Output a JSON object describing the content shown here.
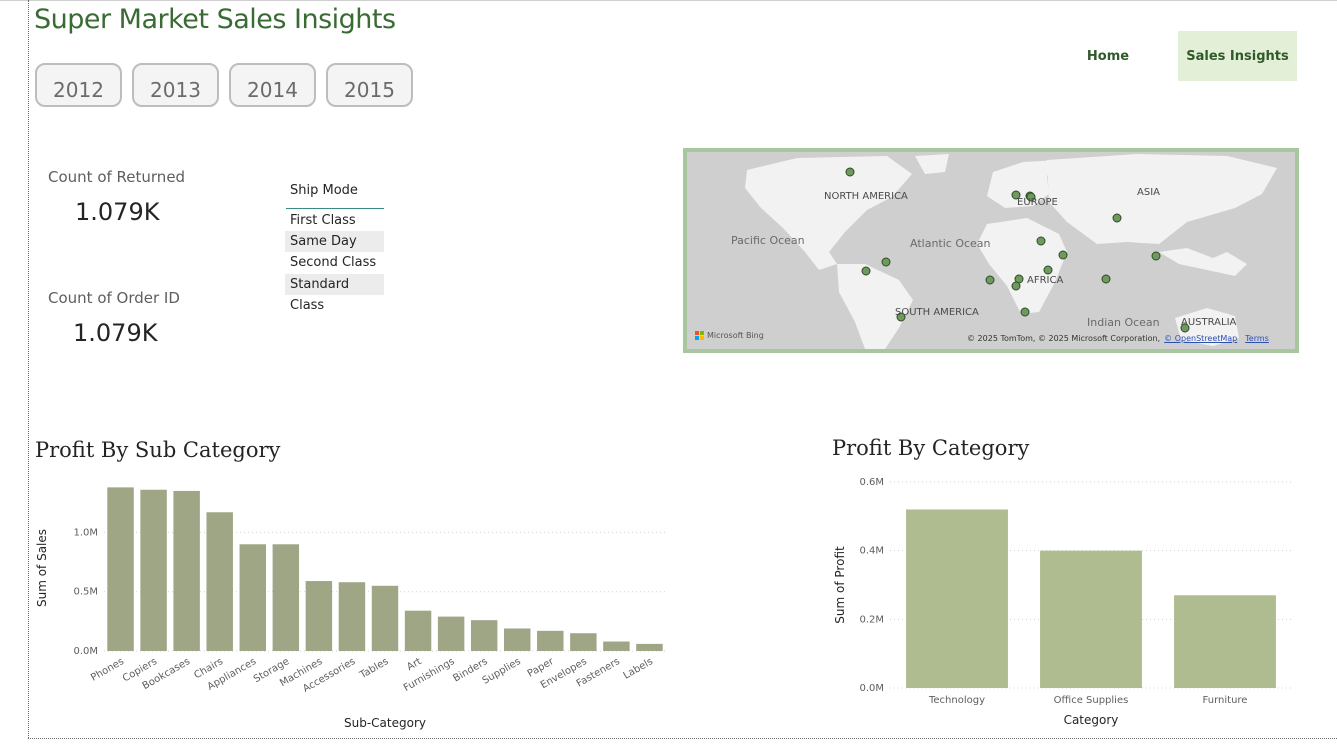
{
  "header": {
    "title": "Super Market Sales Insights",
    "years": [
      "2012",
      "2013",
      "2014",
      "2015"
    ],
    "nav": {
      "home": "Home",
      "sales_insights": "Sales Insights"
    }
  },
  "cards": {
    "returned": {
      "label": "Count of Returned",
      "value": "1.079K"
    },
    "order_id": {
      "label": "Count of Order ID",
      "value": "1.079K"
    }
  },
  "slicer": {
    "title": "Ship Mode",
    "items": [
      "First Class",
      "Same Day",
      "Second Class",
      "Standard Class"
    ]
  },
  "map": {
    "labels": {
      "north_america": "NORTH AMERICA",
      "europe": "EUROPE",
      "asia": "ASIA",
      "africa": "AFRICA",
      "south_america": "SOUTH AMERICA",
      "australia": "AUSTRALIA",
      "pacific": "Pacific Ocean",
      "atlantic": "Atlantic Ocean",
      "indian": "Indian Ocean"
    },
    "bing": "Microsoft Bing",
    "credit": "© 2025 TomTom, © 2025 Microsoft Corporation,",
    "credit_link": "© OpenStreetMap",
    "terms": "Terms",
    "colors": {
      "land": "#f2f2f2",
      "water": "#cfcfcf",
      "border": "#a8c6a0",
      "dot": "#6e9a5e"
    }
  },
  "chart_data": [
    {
      "type": "bar",
      "title": "Profit By Sub Category",
      "xlabel": "Sub-Category",
      "ylabel": "Sum of Sales",
      "categories": [
        "Phones",
        "Copiers",
        "Bookcases",
        "Chairs",
        "Appliances",
        "Storage",
        "Machines",
        "Accessories",
        "Tables",
        "Art",
        "Furnishings",
        "Binders",
        "Supplies",
        "Paper",
        "Envelopes",
        "Fasteners",
        "Labels"
      ],
      "values": [
        1.38,
        1.36,
        1.35,
        1.17,
        0.9,
        0.9,
        0.59,
        0.58,
        0.55,
        0.34,
        0.29,
        0.26,
        0.19,
        0.17,
        0.15,
        0.08,
        0.06
      ],
      "unit": "M",
      "yticks": [
        "0.0M",
        "0.5M",
        "1.0M"
      ],
      "ytick_values": [
        0,
        0.5,
        1.0
      ],
      "ylim": [
        0,
        1.4
      ],
      "grid": true,
      "color": "#9ea686"
    },
    {
      "type": "bar",
      "title": "Profit By Category",
      "xlabel": "Category",
      "ylabel": "Sum of Profit",
      "categories": [
        "Technology",
        "Office Supplies",
        "Furniture"
      ],
      "values": [
        0.52,
        0.4,
        0.27
      ],
      "unit": "M",
      "yticks": [
        "0.0M",
        "0.2M",
        "0.4M",
        "0.6M"
      ],
      "ytick_values": [
        0,
        0.2,
        0.4,
        0.6
      ],
      "ylim": [
        0,
        0.6
      ],
      "grid": true,
      "color": "#aebc8f"
    }
  ]
}
